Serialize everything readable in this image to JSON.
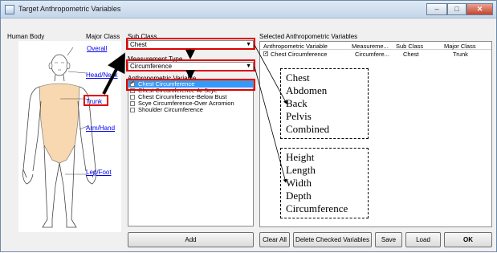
{
  "window": {
    "title": "Target Anthropometric Variables",
    "min_glyph": "–",
    "max_glyph": "□",
    "close_glyph": "✕"
  },
  "columns": {
    "human_body": "Human Body",
    "major_class": "Major Class"
  },
  "major_class_links": [
    "Overall",
    "Head/Neck",
    "Trunk",
    "Arm/Hand",
    "Leg/Foot"
  ],
  "sub_class": {
    "label": "Sub Class",
    "value": "Chest"
  },
  "measurement_type": {
    "label": "Measurement Type",
    "value": "Circumference"
  },
  "anthropometric_variable": {
    "label": "Anthropometric Variable",
    "items": [
      {
        "label": "Chest Circumference",
        "checked": true,
        "selected": true
      },
      {
        "label": "Chest Circumference-At Scye",
        "checked": false,
        "selected": false
      },
      {
        "label": "Chest Circumference-Below Bust",
        "checked": false,
        "selected": false
      },
      {
        "label": "Scye Circumference-Over Acromion",
        "checked": false,
        "selected": false
      },
      {
        "label": "Shoulder Circumference",
        "checked": false,
        "selected": false
      }
    ]
  },
  "selected_panel": {
    "label": "Selected Anthropometric Variables",
    "headers": [
      "Anthropometric Variable",
      "Measureme...",
      "Sub Class",
      "Major Class"
    ],
    "rows": [
      {
        "checked": true,
        "cells": [
          "Chest Circumference",
          "Circumfere...",
          "Chest",
          "Trunk"
        ]
      }
    ]
  },
  "buttons": {
    "add": "Add",
    "clear_all": "Clear All",
    "delete_checked": "Delete Checked Variables",
    "save": "Save",
    "load": "Load",
    "ok": "OK"
  },
  "annotations": {
    "sub_classes": [
      "Chest",
      "Abdomen",
      "Back",
      "Pelvis",
      "Combined"
    ],
    "measurement_types": [
      "Height",
      "Length",
      "Width",
      "Depth",
      "Circumference"
    ]
  },
  "colors": {
    "highlight_box": "#e00000",
    "selection": "#3399ff",
    "skin_fill": "#f8d8b0"
  }
}
